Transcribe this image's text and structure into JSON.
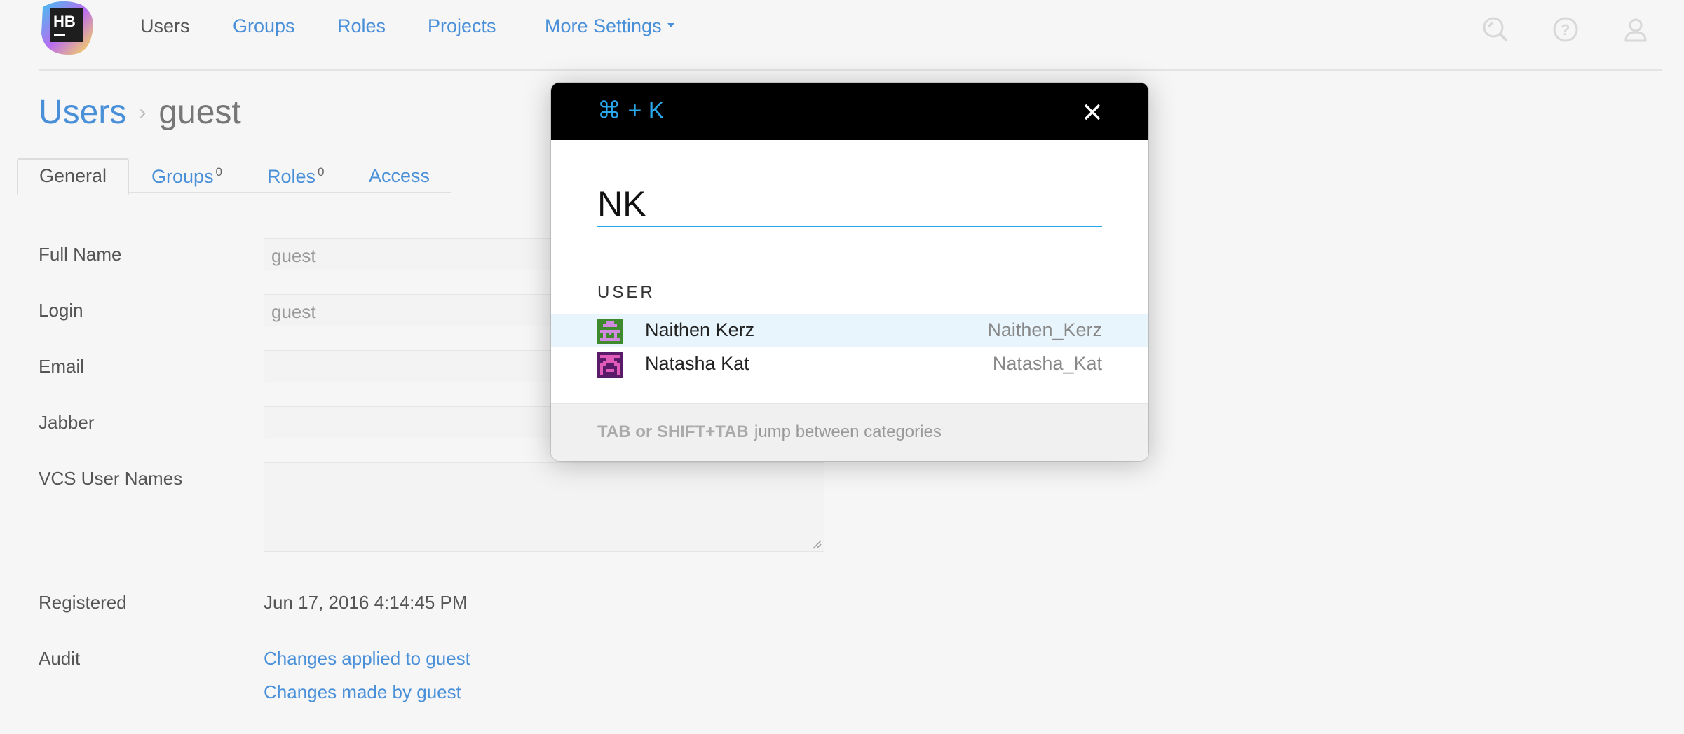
{
  "header": {
    "logo_text": "HB",
    "nav": [
      {
        "label": "Users",
        "active": true
      },
      {
        "label": "Groups"
      },
      {
        "label": "Roles"
      },
      {
        "label": "Projects"
      },
      {
        "label": "More Settings"
      }
    ],
    "icons": [
      "search-icon",
      "help-icon",
      "user-icon"
    ]
  },
  "breadcrumb": {
    "parent": "Users",
    "separator": "›",
    "current": "guest"
  },
  "tabs": [
    {
      "label": "General",
      "active": true
    },
    {
      "label": "Groups",
      "count": "0"
    },
    {
      "label": "Roles",
      "count": "0"
    },
    {
      "label": "Access"
    }
  ],
  "form": {
    "full_name": {
      "label": "Full Name",
      "value": "guest"
    },
    "login": {
      "label": "Login",
      "value": "guest"
    },
    "email": {
      "label": "Email",
      "value": ""
    },
    "jabber": {
      "label": "Jabber",
      "value": ""
    },
    "vcs": {
      "label": "VCS User Names",
      "value": ""
    },
    "registered": {
      "label": "Registered",
      "value": "Jun 17, 2016 4:14:45 PM"
    },
    "audit": {
      "label": "Audit",
      "links": [
        "Changes applied to guest",
        "Changes made by guest"
      ]
    }
  },
  "modal": {
    "shortcut": "⌘ + K",
    "query": "NK",
    "category": "USER",
    "results": [
      {
        "name": "Naithen Kerz",
        "login": "Naithen_Kerz",
        "selected": true
      },
      {
        "name": "Natasha Kat",
        "login": "Natasha_Kat",
        "selected": false
      }
    ],
    "footer": {
      "keys": "TAB or SHIFT+TAB",
      "text": "jump between categories"
    }
  },
  "colors": {
    "link": "#4a90d9",
    "accent": "#29a8ec",
    "selected_row": "#e8f5fc"
  }
}
